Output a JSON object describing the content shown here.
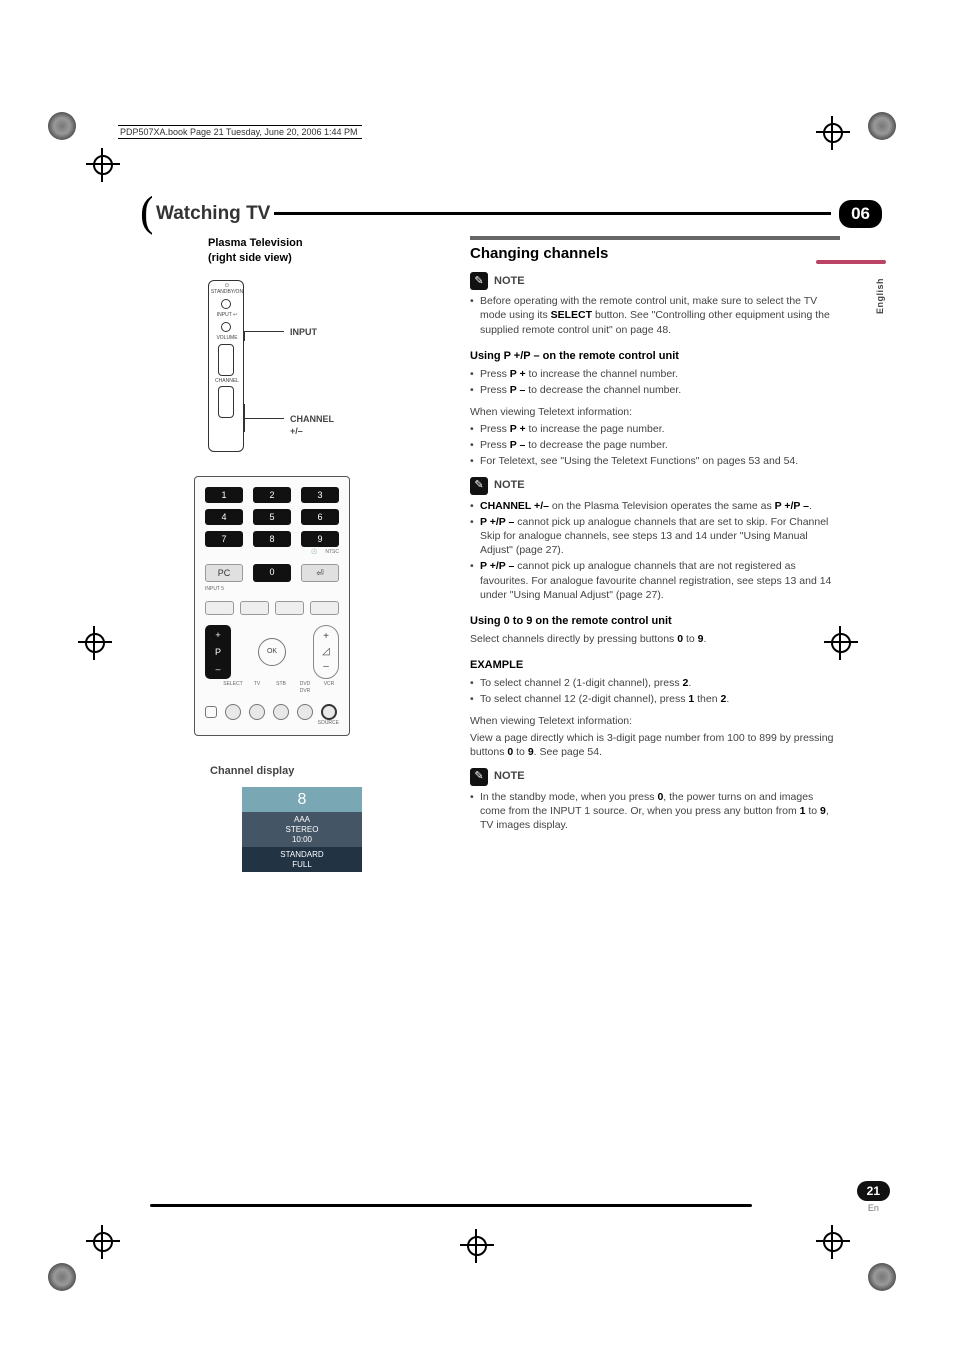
{
  "header_strip": "PDP507XA.book  Page 21  Tuesday, June 20, 2006  1:44 PM",
  "chapter_title": "Watching TV",
  "chapter_number": "06",
  "language_tab": "English",
  "page_number": "21",
  "page_lang_abbr": "En",
  "left": {
    "tv_heading_l1": "Plasma Television",
    "tv_heading_l2": "(right side view)",
    "label_input": "INPUT",
    "label_channel": "CHANNEL +/–",
    "remote": {
      "keys": [
        "1",
        "2",
        "3",
        "4",
        "5",
        "6",
        "7",
        "8",
        "9"
      ],
      "keys_row2": [
        "PC",
        "0",
        "⏎"
      ],
      "tiny_ntsc": "NTSC",
      "tiny_clock": "🕘",
      "inputs_lbl": "INPUT 5",
      "p_plus": "+",
      "p_label": "P",
      "p_minus": "–",
      "ok": "OK",
      "arc_plus": "+",
      "arc_vol": "◿",
      "arc_minus": "–",
      "bottom": [
        "SELECT",
        "TV",
        "STB",
        "DVD DVR",
        "VCR",
        "SOURCE"
      ]
    },
    "chdisp_heading": "Channel display",
    "chdisp": {
      "num": "8",
      "name_l1": "AAA",
      "name_l2": "STEREO",
      "name_l3": "10:00",
      "mode_l1": "STANDARD",
      "mode_l2": "FULL"
    }
  },
  "right": {
    "h2": "Changing channels",
    "note_label": "NOTE",
    "note1": "Before operating with the remote control unit, make sure to select the TV mode using its ",
    "note1_bold": "SELECT",
    "note1_cont": " button. See \"Controlling other equipment using the supplied remote control unit\" on page 48.",
    "h3a": "Using P +/P – on the remote control unit",
    "a1_pre": "Press ",
    "a1_b": "P +",
    "a1_post": " to increase the channel number.",
    "a2_pre": "Press ",
    "a2_b": "P –",
    "a2_post": " to decrease the channel number.",
    "teletext_line": "When viewing Teletext information:",
    "b1_pre": "Press ",
    "b1_b": "P +",
    "b1_post": " to increase the page number.",
    "b2_pre": "Press ",
    "b2_b": "P –",
    "b2_post": " to decrease the page number.",
    "b3": "For Teletext, see \"Using the Teletext Functions\" on pages 53 and 54.",
    "n2_1_b": "CHANNEL +/–",
    "n2_1_post": " on the Plasma Television operates the same as ",
    "n2_1_b2": "P +/P –",
    "n2_1_end": ".",
    "n2_2_b": "P +/P –",
    "n2_2_post": " cannot pick up analogue channels that are set to skip. For Channel Skip for analogue channels, see steps 13 and 14 under \"Using Manual Adjust\" (page 27).",
    "n2_3_b": "P +/P –",
    "n2_3_post": " cannot pick up analogue channels that are not registered as favourites. For analogue favourite channel registration, see steps 13 and 14 under \"Using Manual Adjust\" (page 27).",
    "h3b": "Using 0 to 9 on the remote control unit",
    "sel_pre": "Select channels directly by pressing buttons ",
    "sel_b1": "0",
    "sel_mid": " to ",
    "sel_b2": "9",
    "sel_end": ".",
    "example": "EXAMPLE",
    "ex1_pre": "To select channel 2 (1-digit channel), press ",
    "ex1_b": "2",
    "ex1_end": ".",
    "ex2_pre": "To select channel 12 (2-digit channel), press ",
    "ex2_b1": "1",
    "ex2_mid": " then ",
    "ex2_b2": "2",
    "ex2_end": ".",
    "tt2a": "When viewing Teletext information:",
    "tt2b_pre": "View a page directly which is 3-digit page number from 100 to 899 by pressing buttons ",
    "tt2b_b1": "0",
    "tt2b_mid": " to ",
    "tt2b_b2": "9",
    "tt2b_end": ". See page 54.",
    "n3_pre": "In the standby mode, when you press ",
    "n3_b1": "0",
    "n3_mid": ", the power turns on and images come from the INPUT 1 source. Or, when you press any button from ",
    "n3_b2": "1",
    "n3_mid2": " to ",
    "n3_b3": "9",
    "n3_end": ", TV images display."
  }
}
